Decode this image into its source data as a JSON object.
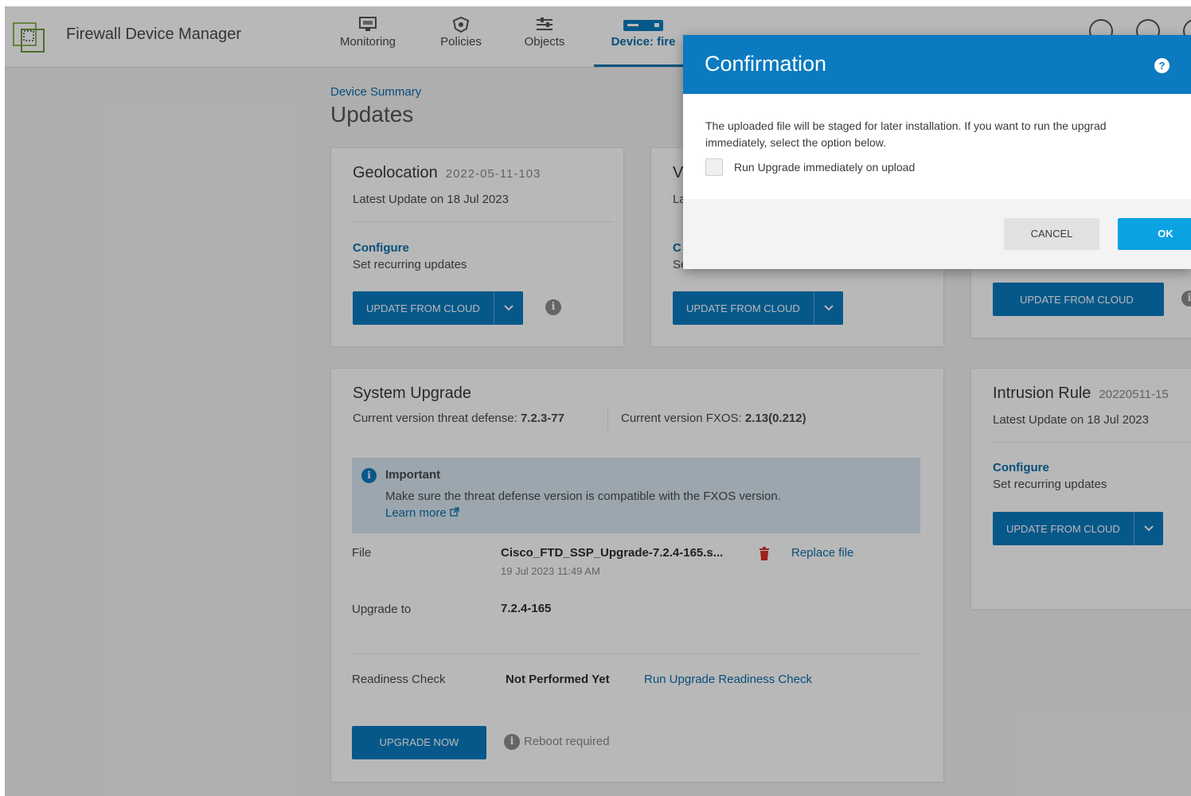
{
  "header": {
    "app_title": "Firewall Device Manager",
    "nav": [
      {
        "label": "Monitoring",
        "icon": "monitoring-icon"
      },
      {
        "label": "Policies",
        "icon": "policies-icon"
      },
      {
        "label": "Objects",
        "icon": "objects-icon"
      },
      {
        "label": "Device: fire",
        "icon": "device-icon",
        "active": true
      }
    ]
  },
  "breadcrumb": "Device Summary",
  "page_title": "Updates",
  "geolocation": {
    "title": "Geolocation",
    "version": "2022-05-11-103",
    "latest": "Latest Update on 18 Jul 2023",
    "configure": "Configure",
    "recurring": "Set recurring updates",
    "button": "UPDATE FROM CLOUD"
  },
  "vdb": {
    "title_partial": "V",
    "latest_partial": "La",
    "configure_partial": "C",
    "recurring_partial": "Se",
    "button": "UPDATE FROM CLOUD"
  },
  "security_intel": {
    "button": "UPDATE FROM CLOUD"
  },
  "system_upgrade": {
    "title": "System Upgrade",
    "threat_label": "Current version threat defense:",
    "threat_value": "7.2.3-77",
    "fxos_label": "Current version FXOS:",
    "fxos_value": "2.13(0.212)",
    "notice_title": "Important",
    "notice_text": "Make sure the threat defense version is compatible with the FXOS version.",
    "learn_more": "Learn more",
    "file_label": "File",
    "file_name": "Cisco_FTD_SSP_Upgrade-7.2.4-165.s...",
    "file_date": "19 Jul 2023 11:49 AM",
    "replace_file": "Replace file",
    "upgrade_to_label": "Upgrade to",
    "upgrade_to_value": "7.2.4-165",
    "readiness_label": "Readiness Check",
    "readiness_value": "Not Performed Yet",
    "readiness_link": "Run Upgrade Readiness Check",
    "upgrade_button": "UPGRADE NOW",
    "reboot_note": "Reboot required"
  },
  "intrusion_rule": {
    "title": "Intrusion Rule",
    "version": "20220511-15",
    "latest": "Latest Update on 18 Jul 2023",
    "configure": "Configure",
    "recurring": "Set recurring updates",
    "button": "UPDATE FROM CLOUD"
  },
  "modal": {
    "title": "Confirmation",
    "body_line1": "The uploaded file will be staged for later installation. If you want to run the upgrad",
    "body_line2": "immediately, select the option below.",
    "checkbox_label": "Run Upgrade immediately on upload",
    "checkbox_checked": false,
    "cancel": "CANCEL",
    "ok": "OK"
  },
  "colors": {
    "brand_blue": "#0b7ac0",
    "ok_blue": "#0ba2e2",
    "link_blue": "#0a6ea8",
    "trash_red": "#d9302b"
  }
}
